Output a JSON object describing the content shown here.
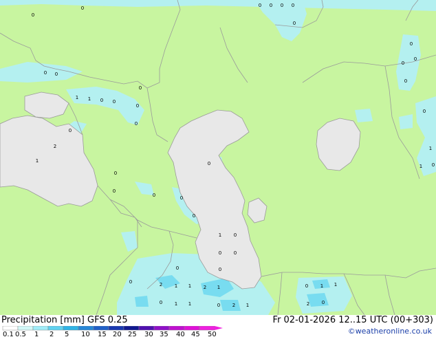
{
  "header": {
    "left_title": "Precipitation [mm]  GFS 0.25",
    "right_title": "Fr 02-01-2026 12..15 UTC (00+303)",
    "credit": "©weatheronline.co.uk"
  },
  "colors": {
    "land": "#c8f5a0",
    "sea": "#e8e8e8",
    "border": "#9a9a9a",
    "precip_light": "#b4f0f0",
    "precip_mid": "#78dcf0"
  },
  "legend": {
    "labels": [
      "0.1",
      "0.5",
      "1",
      "2",
      "5",
      "10",
      "15",
      "20",
      "25",
      "30",
      "35",
      "40",
      "45",
      "50"
    ],
    "colors": [
      "#ffffff",
      "#d2f8f8",
      "#a0ecf8",
      "#60d2f0",
      "#30b4e6",
      "#2888d8",
      "#2060c8",
      "#1838b0",
      "#101890",
      "#5010b0",
      "#9010c8",
      "#c010d0",
      "#e010d8",
      "#f020e0"
    ]
  },
  "map_values": [
    {
      "text": "0"
    },
    {
      "text": "0"
    },
    {
      "text": "0"
    },
    {
      "text": "0"
    },
    {
      "text": "0"
    },
    {
      "text": "0"
    },
    {
      "text": "0"
    },
    {
      "text": "0"
    },
    {
      "text": "1"
    },
    {
      "text": "1"
    },
    {
      "text": "0"
    },
    {
      "text": "0"
    },
    {
      "text": "0"
    },
    {
      "text": "0"
    },
    {
      "text": "0"
    },
    {
      "text": "2"
    },
    {
      "text": "1"
    },
    {
      "text": "0"
    },
    {
      "text": "0"
    },
    {
      "text": "0"
    },
    {
      "text": "0"
    },
    {
      "text": "0"
    },
    {
      "text": "0"
    },
    {
      "text": "0"
    },
    {
      "text": "0"
    },
    {
      "text": "1"
    },
    {
      "text": "0"
    },
    {
      "text": "0"
    },
    {
      "text": "0"
    },
    {
      "text": "0"
    },
    {
      "text": "0"
    },
    {
      "text": "2"
    },
    {
      "text": "1"
    },
    {
      "text": "1"
    },
    {
      "text": "2"
    },
    {
      "text": "1"
    },
    {
      "text": "0"
    },
    {
      "text": "0"
    },
    {
      "text": "1"
    },
    {
      "text": "1"
    },
    {
      "text": "0"
    },
    {
      "text": "2"
    },
    {
      "text": "1"
    },
    {
      "text": "0"
    },
    {
      "text": "1"
    },
    {
      "text": "1"
    },
    {
      "text": "2"
    },
    {
      "text": "0"
    },
    {
      "text": "0"
    },
    {
      "text": "1"
    },
    {
      "text": "1"
    },
    {
      "text": "0"
    },
    {
      "text": "0"
    },
    {
      "text": "0"
    },
    {
      "text": "0"
    },
    {
      "text": "0"
    }
  ]
}
